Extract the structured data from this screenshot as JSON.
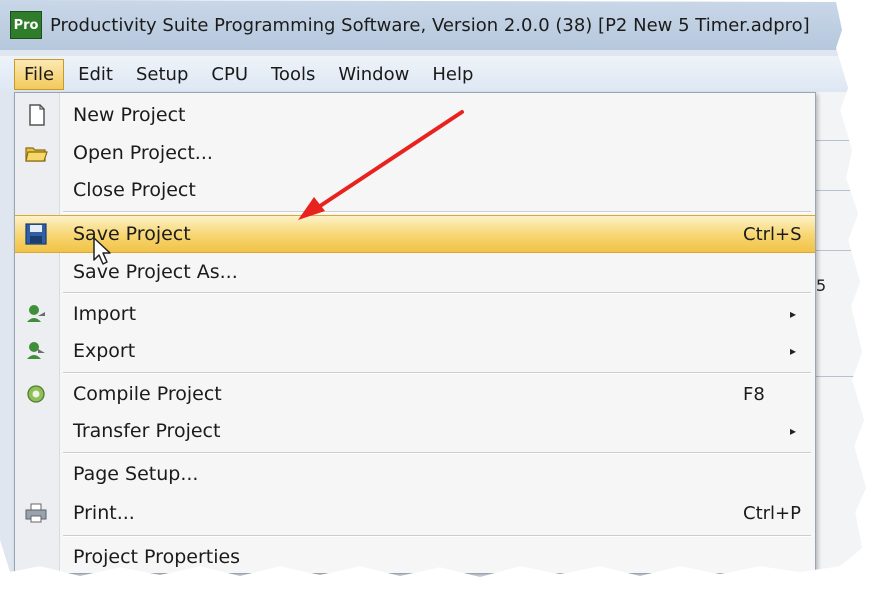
{
  "window": {
    "app_icon_text": "Pro",
    "title": "Productivity Suite Programming Software, Version 2.0.0 (38)   [P2 New 5 Timer.adpro]"
  },
  "menubar": {
    "items": [
      "File",
      "Edit",
      "Setup",
      "CPU",
      "Tools",
      "Window",
      "Help"
    ],
    "active": "File"
  },
  "background_fragment": "5",
  "file_menu": {
    "items": [
      {
        "label": "New Project",
        "icon": "new-document-icon"
      },
      {
        "label": "Open Project...",
        "icon": "open-folder-icon"
      },
      {
        "label": "Close Project"
      },
      {
        "label": "Save Project",
        "shortcut": "Ctrl+S",
        "icon": "floppy-disk-icon",
        "highlighted": true
      },
      {
        "label": "Save Project As..."
      },
      {
        "label": "Import",
        "icon": "import-icon",
        "submenu": true
      },
      {
        "label": "Export",
        "icon": "export-icon",
        "submenu": true
      },
      {
        "label": "Compile Project",
        "shortcut": "F8",
        "icon": "compile-icon"
      },
      {
        "label": "Transfer Project",
        "submenu": true
      },
      {
        "label": "Page Setup..."
      },
      {
        "label": "Print...",
        "shortcut": "Ctrl+P",
        "icon": "printer-icon"
      },
      {
        "label": "Project Properties"
      }
    ],
    "submenu_glyph": "▸"
  },
  "annotation": {
    "arrow_color": "#e8231f"
  },
  "colors": {
    "highlight": "#f3c95a",
    "menu_bg": "#f6f6f6"
  }
}
